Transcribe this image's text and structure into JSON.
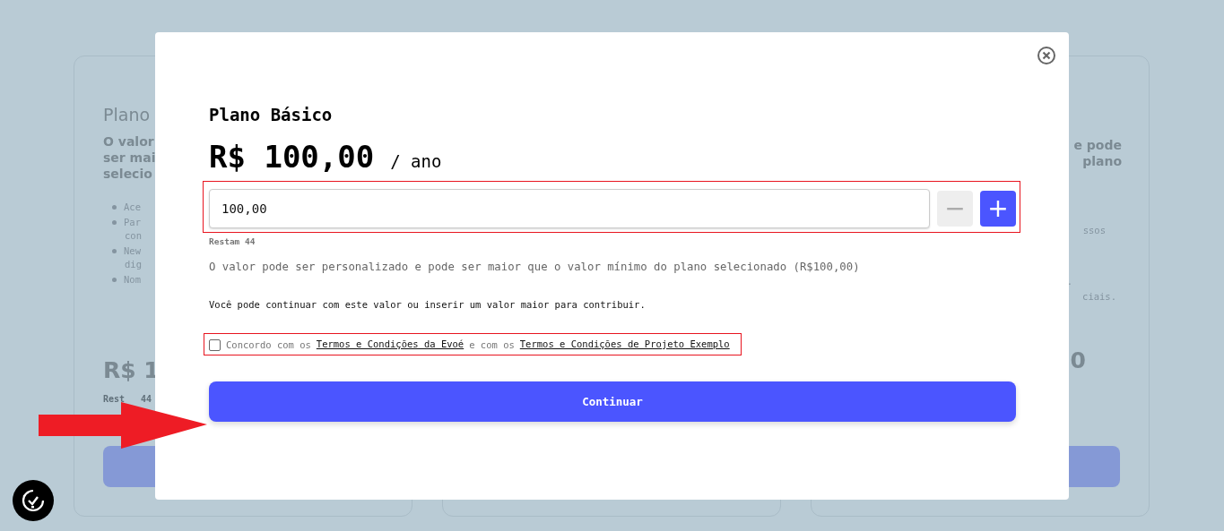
{
  "background_cards": [
    {
      "title": "Plano",
      "description_lines": [
        "O valor",
        "ser mai",
        "selecio"
      ],
      "features": [
        "Ace",
        "Par",
        "con",
        "New",
        "dig",
        "Nom"
      ],
      "price": "R$ 1",
      "remaining": [
        "Rest",
        "44"
      ]
    },
    {
      "description_lines": [
        "e pode",
        "plano"
      ],
      "features": [
        "ssos",
        ".",
        "ciais."
      ],
      "price": "0"
    }
  ],
  "modal": {
    "plan_name": "Plano Básico",
    "price": "R$ 100,00",
    "period": "/ ano",
    "amount_field": {
      "value": "100,00"
    },
    "decrement": {
      "label": "−",
      "disabled": true
    },
    "increment": {
      "label": "+",
      "disabled": false
    },
    "remaining": "Restam 44",
    "note": "O valor pode ser personalizado e pode ser maior que o valor mínimo do plano selecionado (R$100,00)",
    "hint": "Você pode continuar com este valor ou inserir um valor maior para contribuir.",
    "terms": {
      "checked": false,
      "parts": [
        {
          "kind": "text",
          "text": "Concordo com os"
        },
        {
          "kind": "link",
          "text": "Termos e Condições da Evoé"
        },
        {
          "kind": "text",
          "text": "e com os"
        },
        {
          "kind": "link",
          "text": "Termos e Condições de Projeto Exemplo"
        }
      ]
    },
    "continue_button": "Continuar"
  }
}
